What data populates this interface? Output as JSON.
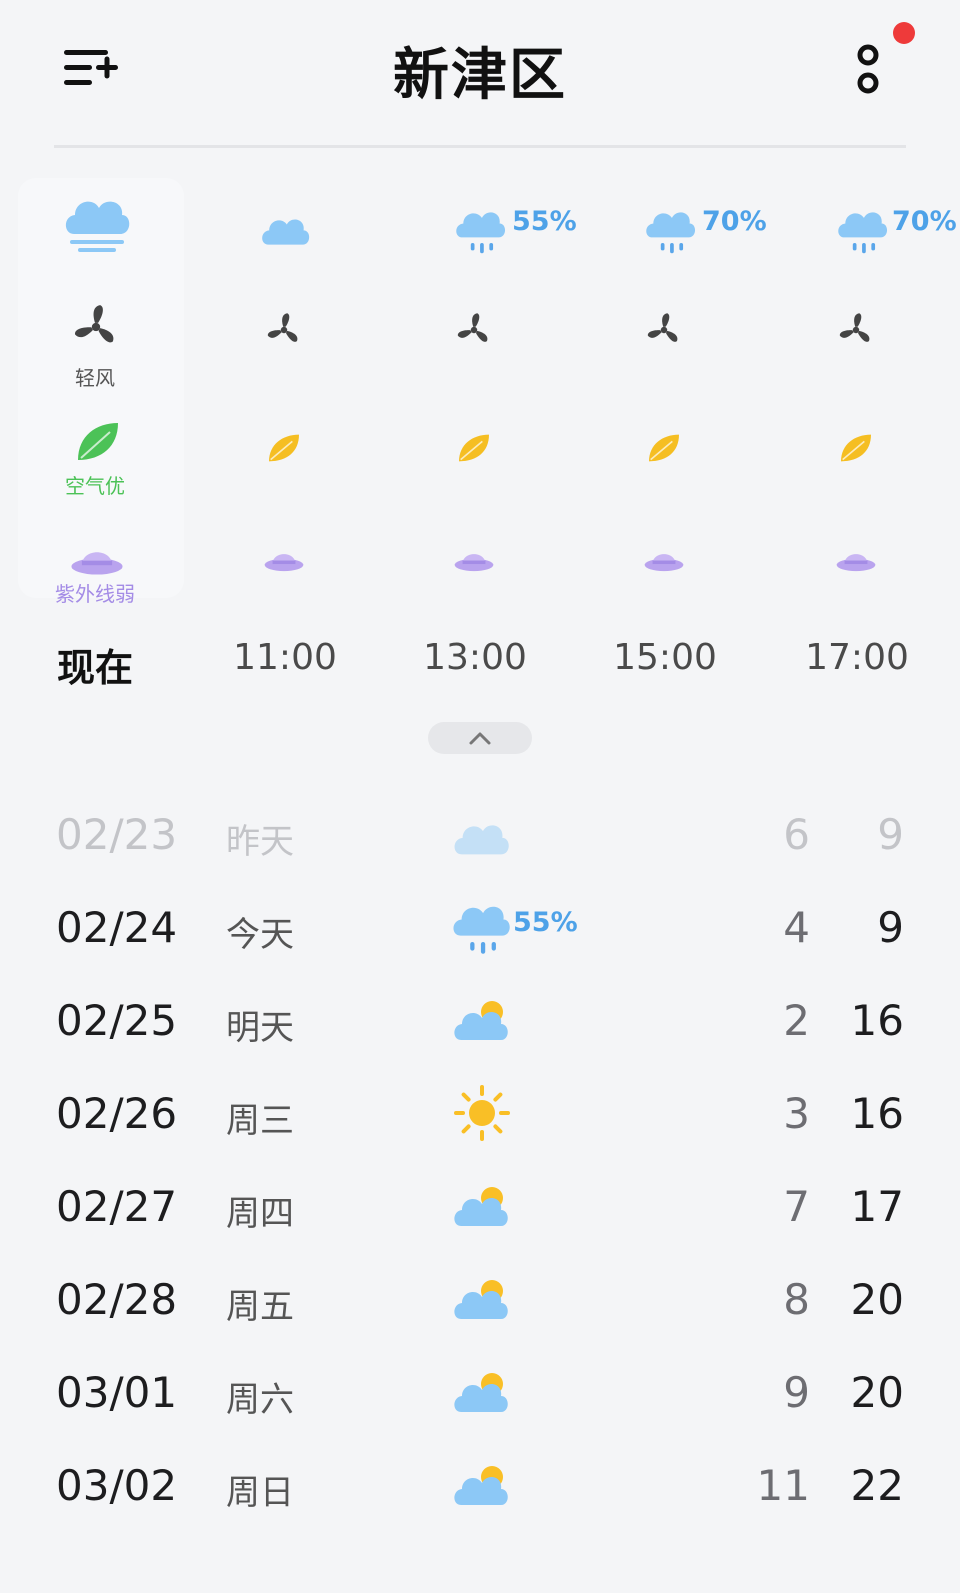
{
  "header": {
    "title": "新津区",
    "menu_icon": "list-add-icon",
    "more_icon": "more-vertical-icon",
    "notification_color": "#ee3a3a"
  },
  "hourly": [
    {
      "time": "现在",
      "weather_icon": "cloud-fog-icon",
      "wind_label": "轻风",
      "air_label": "空气优",
      "uv_label": "紫外线弱"
    },
    {
      "time": "11:00",
      "weather_icon": "cloud-icon"
    },
    {
      "time": "13:00",
      "weather_icon": "cloud-rain-icon",
      "precip": "55%"
    },
    {
      "time": "15:00",
      "weather_icon": "cloud-rain-icon",
      "precip": "70%"
    },
    {
      "time": "17:00",
      "weather_icon": "cloud-rain-icon",
      "precip": "70%"
    }
  ],
  "daily": [
    {
      "date": "02/23",
      "day": "昨天",
      "icon": "cloud-icon",
      "low": "6",
      "high": "9"
    },
    {
      "date": "02/24",
      "day": "今天",
      "icon": "cloud-rain-icon",
      "precip": "55%",
      "low": "4",
      "high": "9"
    },
    {
      "date": "02/25",
      "day": "明天",
      "icon": "partly-cloudy-icon",
      "low": "2",
      "high": "16"
    },
    {
      "date": "02/26",
      "day": "周三",
      "icon": "sun-icon",
      "low": "3",
      "high": "16"
    },
    {
      "date": "02/27",
      "day": "周四",
      "icon": "partly-cloudy-icon",
      "low": "7",
      "high": "17"
    },
    {
      "date": "02/28",
      "day": "周五",
      "icon": "partly-cloudy-icon",
      "low": "8",
      "high": "20"
    },
    {
      "date": "03/01",
      "day": "周六",
      "icon": "partly-cloudy-icon",
      "low": "9",
      "high": "20"
    },
    {
      "date": "03/02",
      "day": "周日",
      "icon": "partly-cloudy-icon",
      "low": "11",
      "high": "22"
    }
  ],
  "colors": {
    "cloud": "#8cc8f6",
    "rain": "#5aa6ea",
    "sun": "#f9bf26",
    "leaf_good": "#4cc257",
    "leaf_warn": "#f5be22",
    "uv": "#b9a3ee",
    "wind": "#444444"
  }
}
